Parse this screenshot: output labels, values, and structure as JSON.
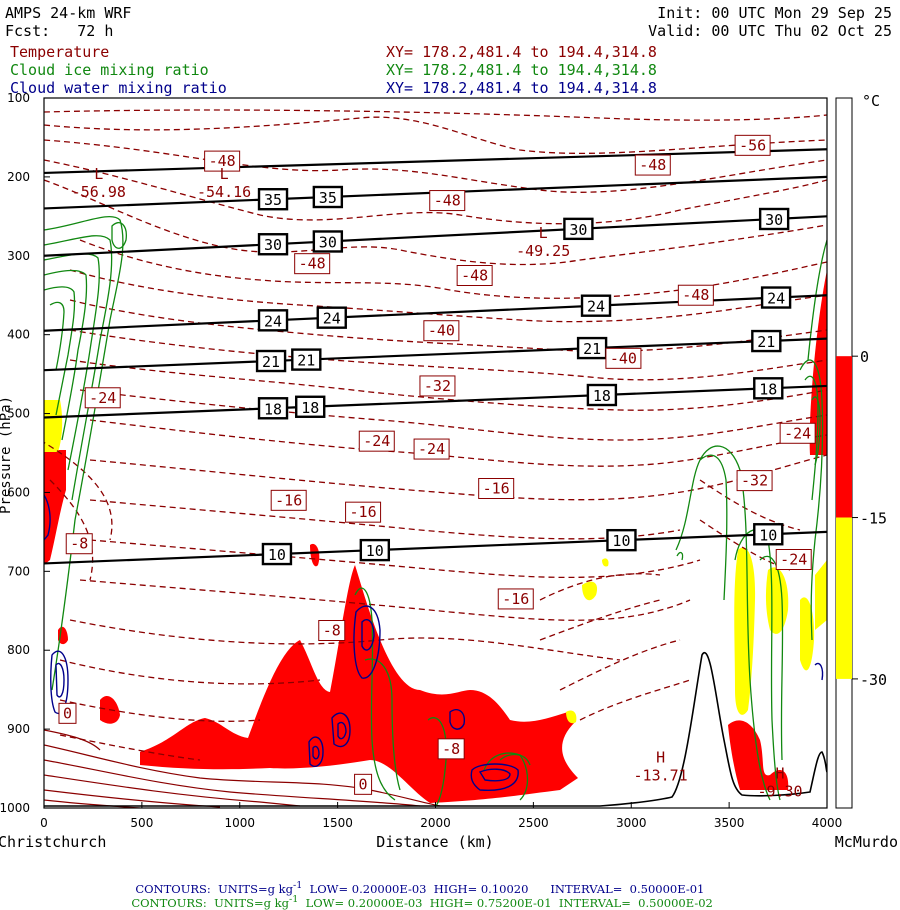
{
  "header": {
    "model": "AMPS 24-km WRF",
    "forecast": "Fcst:   72 h",
    "init": "Init: 00 UTC Mon 29 Sep 25",
    "valid": "Valid: 00 UTC Thu 02 Oct 25",
    "fields": [
      {
        "name": "Temperature",
        "xy": "XY= 178.2,481.4 to 194.4,314.8",
        "color": "#8b0000"
      },
      {
        "name": "Cloud ice mixing ratio",
        "xy": "XY= 178.2,481.4 to 194.4,314.8",
        "color": "#118811"
      },
      {
        "name": "Cloud water mixing ratio",
        "xy": "XY= 178.2,481.4 to 194.4,314.8",
        "color": "#00008b"
      }
    ]
  },
  "chart_data": {
    "type": "cross-section",
    "xlabel": "Distance (km)",
    "ylabel": "Pressure (hPa)",
    "x_ticks": [
      0,
      500,
      1000,
      1500,
      2000,
      2500,
      3000,
      3500,
      4000
    ],
    "y_ticks": [
      100,
      200,
      300,
      400,
      500,
      600,
      700,
      800,
      900,
      1000
    ],
    "xlim": [
      0,
      4000
    ],
    "ylim": [
      1000,
      100
    ],
    "endpoints": {
      "left": "Christchurch",
      "right": "McMurdo"
    },
    "colorbar": {
      "unit": "°C",
      "ticks": [
        0,
        -15,
        -30
      ],
      "bands": [
        {
          "from": 0,
          "to": -15,
          "color": "#ff0000"
        },
        {
          "from": -15,
          "to": -30,
          "color": "#ffff00"
        }
      ]
    },
    "theta_lines": [
      {
        "label": "10",
        "start": 690,
        "end": 650,
        "label_x": [
          1190,
          1690,
          2950,
          3700
        ]
      },
      {
        "label": "18",
        "start": 505,
        "end": 465,
        "label_x": [
          1170,
          1360,
          2850,
          3700
        ]
      },
      {
        "label": "21",
        "start": 445,
        "end": 405,
        "label_x": [
          1160,
          1340,
          2800,
          3690
        ]
      },
      {
        "label": "24",
        "start": 395,
        "end": 350,
        "label_x": [
          1170,
          1470,
          2820,
          3740
        ]
      },
      {
        "label": "30",
        "start": 300,
        "end": 250,
        "label_x": [
          1170,
          1450,
          2730,
          3730
        ]
      },
      {
        "label": "35",
        "start": 240,
        "end": 200,
        "label_x": [
          1170,
          1450
        ]
      },
      {
        "label": "",
        "start": 195,
        "end": 165,
        "label_x": []
      }
    ],
    "temperature_labels": [
      {
        "label": "-56",
        "x": 3620,
        "p": 160
      },
      {
        "label": "-48",
        "x": 910,
        "p": 180
      },
      {
        "label": "-48",
        "x": 3110,
        "p": 185
      },
      {
        "label": "-48",
        "x": 2060,
        "p": 230
      },
      {
        "label": "-48",
        "x": 1370,
        "p": 310
      },
      {
        "label": "-48",
        "x": 2200,
        "p": 325
      },
      {
        "label": "-48",
        "x": 3330,
        "p": 350
      },
      {
        "label": "-40",
        "x": 2030,
        "p": 395
      },
      {
        "label": "-40",
        "x": 2960,
        "p": 430
      },
      {
        "label": "-32",
        "x": 2010,
        "p": 465
      },
      {
        "label": "-32",
        "x": 3630,
        "p": 585
      },
      {
        "label": "-24",
        "x": 3850,
        "p": 525
      },
      {
        "label": "-24",
        "x": 300,
        "p": 480
      },
      {
        "label": "-24",
        "x": 1700,
        "p": 535
      },
      {
        "label": "-24",
        "x": 1980,
        "p": 545
      },
      {
        "label": "-24",
        "x": 3830,
        "p": 685
      },
      {
        "label": "-16",
        "x": 2310,
        "p": 595
      },
      {
        "label": "-16",
        "x": 1250,
        "p": 610
      },
      {
        "label": "-16",
        "x": 1630,
        "p": 625
      },
      {
        "label": "-16",
        "x": 2410,
        "p": 735
      },
      {
        "label": "-8",
        "x": 180,
        "p": 665
      },
      {
        "label": "-8",
        "x": 1470,
        "p": 775
      },
      {
        "label": "-8",
        "x": 2080,
        "p": 925
      },
      {
        "label": "0",
        "x": 120,
        "p": 880
      },
      {
        "label": "0",
        "x": 1630,
        "p": 970
      }
    ],
    "extrema": [
      {
        "type": "L",
        "value": "-56.98",
        "x": 280,
        "p": 210
      },
      {
        "type": "L",
        "value": "-54.16",
        "x": 920,
        "p": 210
      },
      {
        "type": "L",
        "value": "-49.25",
        "x": 2550,
        "p": 285
      },
      {
        "type": "H",
        "value": "-13.71",
        "x": 3150,
        "p": 950
      },
      {
        "type": "H",
        "value": "-9.30",
        "x": 3760,
        "p": 970
      }
    ],
    "contour_info": [
      {
        "text": "CONTOURS:  UNITS=g kg",
        "sup": "-1",
        "rest": "  LOW= 0.20000E-03  HIGH= 0.10020      INTERVAL=  0.50000E-01",
        "color": "#00008b"
      },
      {
        "text": "CONTOURS:  UNITS=g kg",
        "sup": "-1",
        "rest": "  LOW= 0.20000E-03  HIGH= 0.75200E-01  INTERVAL=  0.50000E-02",
        "color": "#118811"
      }
    ]
  }
}
